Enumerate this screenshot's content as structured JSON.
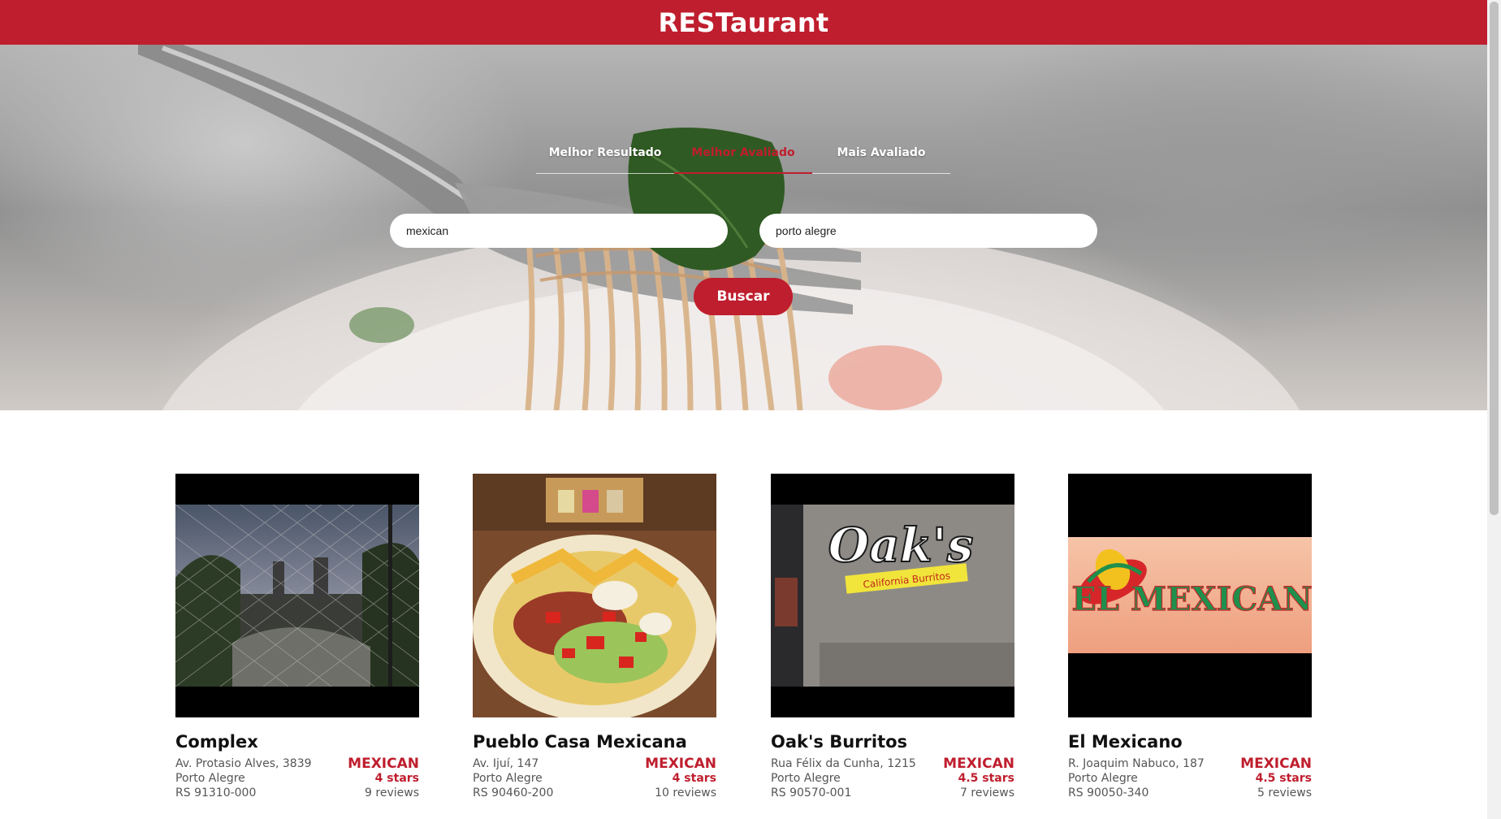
{
  "header": {
    "brand": "RESTaurant"
  },
  "search": {
    "tabs": [
      {
        "label": "Melhor Resultado",
        "active": false
      },
      {
        "label": "Melhor Avaliado",
        "active": true
      },
      {
        "label": "Mais Avaliado",
        "active": false
      }
    ],
    "term_value": "mexican",
    "location_value": "porto alegre",
    "button_label": "Buscar"
  },
  "results": [
    {
      "name": "Complex",
      "address_line1": "Av. Protasio Alves, 3839",
      "city": "Porto Alegre",
      "state_zip": "RS 91310-000",
      "category": "MEXICAN",
      "rating": "4 stars",
      "reviews": "9 reviews",
      "image": "night-fence-photo"
    },
    {
      "name": "Pueblo Casa Mexicana",
      "address_line1": "Av. Ijuí, 147",
      "city": "Porto Alegre",
      "state_zip": "RS 90460-200",
      "category": "MEXICAN",
      "rating": "4 stars",
      "reviews": "10 reviews",
      "image": "taco-plate-photo"
    },
    {
      "name": "Oak's Burritos",
      "address_line1": "Rua Félix da Cunha, 1215",
      "city": "Porto Alegre",
      "state_zip": "RS 90570-001",
      "category": "MEXICAN",
      "rating": "4.5 stars",
      "reviews": "7 reviews",
      "image": "storefront-sign-photo",
      "sign_text": "Oak's",
      "sign_subtext": "California Burritos"
    },
    {
      "name": "El Mexicano",
      "address_line1": "R. Joaquim Nabuco, 187",
      "city": "Porto Alegre",
      "state_zip": "RS 90050-340",
      "category": "MEXICAN",
      "rating": "4.5 stars",
      "reviews": "5 reviews",
      "image": "logo-banner-photo",
      "logo_text": "EL MEXICANO"
    }
  ],
  "colors": {
    "brand": "#bf1e2e",
    "background": "#ffffff"
  }
}
